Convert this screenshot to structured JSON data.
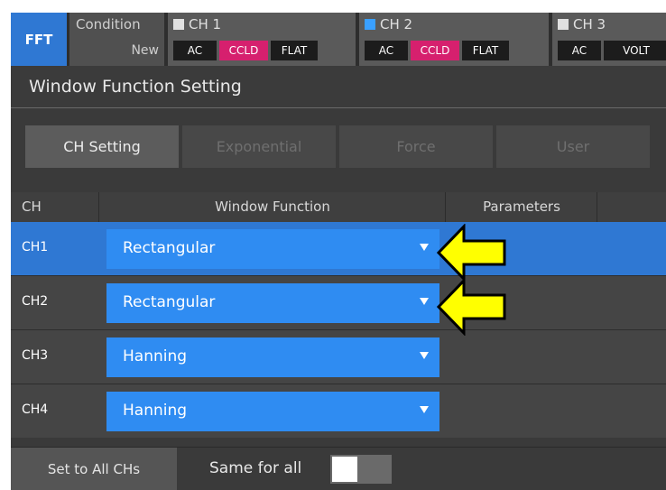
{
  "header": {
    "mode": "FFT",
    "condition_label": "Condition",
    "condition_value": "New",
    "channels": [
      {
        "name": "CH 1",
        "color": "#e0e0e0",
        "chips": [
          "AC",
          "CCLD",
          "FLAT"
        ]
      },
      {
        "name": "CH 2",
        "color": "#3aa0ff",
        "chips": [
          "AC",
          "CCLD",
          "FLAT"
        ]
      },
      {
        "name": "CH 3",
        "color": "#e0e0e0",
        "chips": [
          "AC",
          "VOLT"
        ]
      }
    ]
  },
  "title": "Window Function Setting",
  "tabs": [
    "CH Setting",
    "Exponential",
    "Force",
    "User"
  ],
  "table": {
    "headers": [
      "CH",
      "Window Function",
      "Parameters"
    ],
    "rows": [
      {
        "ch": "CH1",
        "window": "Rectangular",
        "selected": true
      },
      {
        "ch": "CH2",
        "window": "Rectangular",
        "selected": false
      },
      {
        "ch": "CH3",
        "window": "Hanning",
        "selected": false
      },
      {
        "ch": "CH4",
        "window": "Hanning",
        "selected": false
      }
    ]
  },
  "bottom": {
    "set_all_label": "Set to All CHs",
    "same_for_all_label": "Same for all",
    "same_for_all_on": false
  },
  "colors": {
    "accent": "#2f78d3",
    "dropdown": "#2f8cf2",
    "ccld": "#d6206e",
    "annotation_arrow": "#ffff00"
  },
  "icons": {
    "dropdown_arrow": "triangle-down-icon",
    "annotation": "yellow-arrow-left-icon"
  }
}
